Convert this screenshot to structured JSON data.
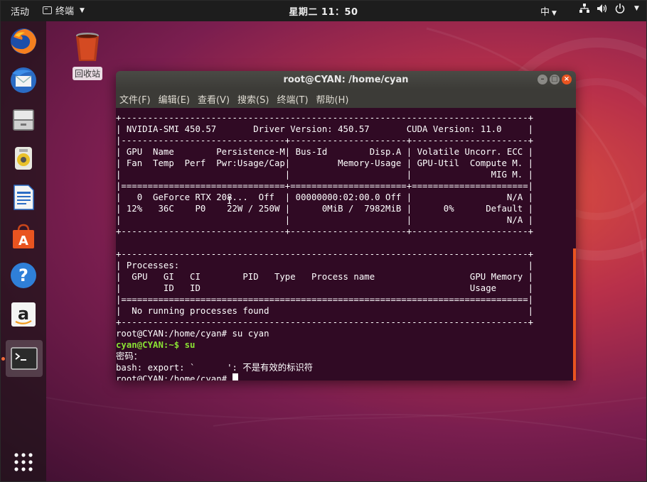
{
  "topbar": {
    "activities": "活动",
    "app_menu": "终端",
    "clock": "星期二 11：50",
    "ime": "中"
  },
  "dock": {
    "items": [
      "firefox-icon",
      "thunderbird-icon",
      "files-icon",
      "rhythmbox-icon",
      "libreoffice-writer-icon",
      "software-center-icon",
      "help-icon",
      "amazon-icon",
      "terminal-icon"
    ],
    "apps_grid": "show-applications-icon"
  },
  "desktop": {
    "trash_label": "回收站"
  },
  "window": {
    "title": "root@CYAN: /home/cyan",
    "menu": [
      "文件(F)",
      "编辑(E)",
      "查看(V)",
      "搜索(S)",
      "终端(T)",
      "帮助(H)"
    ]
  },
  "terminal": {
    "lines": [
      "+-----------------------------------------------------------------------------+",
      "| NVIDIA-SMI 450.57       Driver Version: 450.57       CUDA Version: 11.0     |",
      "|-------------------------------+----------------------+----------------------+",
      "| GPU  Name        Persistence-M| Bus-Id        Disp.A | Volatile Uncorr. ECC |",
      "| Fan  Temp  Perf  Pwr:Usage/Cap|         Memory-Usage | GPU-Util  Compute M. |",
      "|                               |                      |               MIG M. |",
      "|===============================+======================+======================|",
      "|   0  GeForce RTX 208...  Off  | 00000000:02:00.0 Off |                  N/A |",
      "| 12%   36C    P0    22W / 250W |      0MiB /  7982MiB |      0%      Default |",
      "|                               |                      |                  N/A |",
      "+-------------------------------+----------------------+----------------------+",
      "",
      "+-----------------------------------------------------------------------------+",
      "| Processes:                                                                  |",
      "|  GPU   GI   CI        PID   Type   Process name                  GPU Memory |",
      "|        ID   ID                                                   Usage      |",
      "|=============================================================================|",
      "|  No running processes found                                                 |",
      "+-----------------------------------------------------------------------------+",
      "root@CYAN:/home/cyan# su cyan"
    ],
    "user_prompt": "cyan@CYAN:~$ su",
    "password_line": "密码：",
    "error_line": "bash: export: `      ': 不是有效的标识符",
    "final_prompt": "root@CYAN:/home/cyan# ",
    "colors": {
      "background": "#300a24",
      "text": "#ffffff",
      "user_prompt": "#8ae234"
    }
  }
}
